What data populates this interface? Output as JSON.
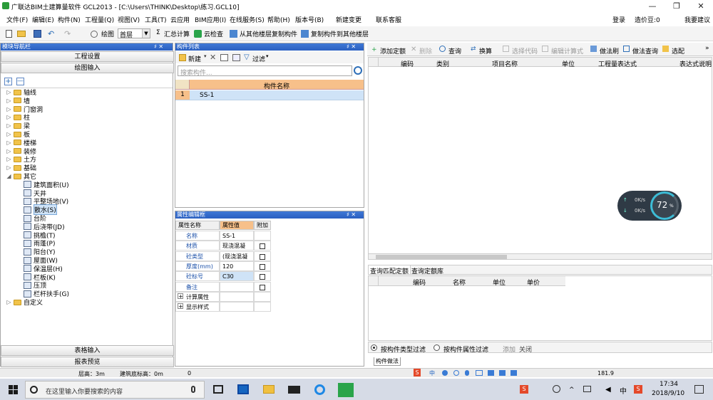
{
  "window": {
    "title": "广联达BIM土建算量软件 GCL2013 - [C:\\Users\\THINK\\Desktop\\练习.GCL10]",
    "minimize": "—",
    "restore": "❐",
    "close": "✕"
  },
  "menu": {
    "items": [
      "文件(F)",
      "编辑(E)",
      "构件(N)",
      "工程量(Q)",
      "视图(V)",
      "工具(T)",
      "云应用",
      "BIM应用(I)",
      "在线服务(S)",
      "帮助(H)",
      "版本号(B)",
      "新建变更",
      "联系客服"
    ],
    "right_items": [
      "登录",
      "造价豆:0",
      "我要建议"
    ]
  },
  "toolbar": {
    "draw": "绘图",
    "floor": "首层",
    "sum_calc": "汇总计算",
    "cloud_check": "云检查",
    "copy_from": "从其他楼层复制构件",
    "copy_to": "复制构件到其他楼层",
    "sigma": "Σ"
  },
  "left_nav": {
    "header": "模块导航栏",
    "pin": "♯ ✕",
    "btn_project_settings": "工程设置",
    "btn_drawing_input": "绘图输入",
    "btn_table_input": "表格输入",
    "btn_report_preview": "报表预览",
    "add": "+",
    "remove": "—",
    "tree": [
      {
        "label": "轴线",
        "type": "folder",
        "expander": "▷"
      },
      {
        "label": "墙",
        "type": "folder",
        "expander": "▷"
      },
      {
        "label": "门窗洞",
        "type": "folder",
        "expander": "▷"
      },
      {
        "label": "柱",
        "type": "folder",
        "expander": "▷"
      },
      {
        "label": "梁",
        "type": "folder",
        "expander": "▷"
      },
      {
        "label": "板",
        "type": "folder",
        "expander": "▷"
      },
      {
        "label": "楼梯",
        "type": "folder",
        "expander": "▷"
      },
      {
        "label": "装修",
        "type": "folder",
        "expander": "▷"
      },
      {
        "label": "土方",
        "type": "folder",
        "expander": "▷"
      },
      {
        "label": "基础",
        "type": "folder",
        "expander": "▷"
      },
      {
        "label": "其它",
        "type": "folder",
        "expander": "◢"
      },
      {
        "label": "建筑面积(U)",
        "type": "child"
      },
      {
        "label": "天井",
        "type": "child"
      },
      {
        "label": "平整场地(V)",
        "type": "child"
      },
      {
        "label": "散水(S)",
        "type": "child",
        "selected": true
      },
      {
        "label": "台阶",
        "type": "child"
      },
      {
        "label": "后浇带(JD)",
        "type": "child"
      },
      {
        "label": "挑檐(T)",
        "type": "child"
      },
      {
        "label": "雨蓬(P)",
        "type": "child"
      },
      {
        "label": "阳台(Y)",
        "type": "child"
      },
      {
        "label": "屋面(W)",
        "type": "child"
      },
      {
        "label": "保温层(H)",
        "type": "child"
      },
      {
        "label": "栏板(K)",
        "type": "child"
      },
      {
        "label": "压顶",
        "type": "child"
      },
      {
        "label": "栏杆扶手(G)",
        "type": "child"
      },
      {
        "label": "自定义",
        "type": "folder",
        "expander": "▷"
      }
    ]
  },
  "component_list": {
    "header": "构件列表",
    "pin": "♯ ✕",
    "new": "新建",
    "filter": "过滤",
    "search_placeholder": "搜索构件...",
    "column": "构件名称",
    "rows": [
      {
        "index": "1",
        "name": "SS-1"
      }
    ]
  },
  "property_editor": {
    "header": "属性编辑框",
    "pin": "♯ ✕",
    "columns": [
      "属性名称",
      "属性值",
      "附加"
    ],
    "rows": [
      {
        "name": "名称",
        "value": "SS-1",
        "has_check": false
      },
      {
        "name": "材质",
        "value": "现浇混凝",
        "has_check": true
      },
      {
        "name": "砼类型",
        "value": "(现浇混凝",
        "has_check": true
      },
      {
        "name": "厚度(mm)",
        "value": "120",
        "has_check": true
      },
      {
        "name": "砼标号",
        "value": "C30",
        "has_check": true
      },
      {
        "name": "备注",
        "value": "",
        "has_check": true
      }
    ],
    "groups": [
      "计算属性",
      "显示样式"
    ],
    "plus": "+"
  },
  "right": {
    "toolbar": [
      "添加定额",
      "删除",
      "查询",
      "换算",
      "选择代码",
      "编辑计算式",
      "做法刷",
      "做法查询",
      "选配"
    ],
    "columns": [
      "编码",
      "类别",
      "项目名称",
      "单位",
      "工程量表达式",
      "表达式说明"
    ],
    "tabs": [
      "查询匹配定额",
      "查询定额库"
    ],
    "lower_columns": [
      "编码",
      "名称",
      "单位",
      "单价"
    ],
    "radio1": "按构件类型过滤",
    "radio2": "按构件属性过滤",
    "add": "添加",
    "close": "关闭",
    "bottom_tab": "构件做法",
    "speed_up": "0K/s",
    "speed_down": "0K/s",
    "percent": "72",
    "percent_unit": "%"
  },
  "status": {
    "floor_height": "层高：3m",
    "base_elev": "建筑底标高：0m",
    "zero": "0",
    "coord": "181.9"
  },
  "taskbar": {
    "search": "在这里输入你要搜索的内容",
    "time": "17:34",
    "date": "2018/9/10",
    "ime": "中",
    "sogou": "S"
  },
  "colors": {
    "panel_header": "#2a5fc0",
    "selected_row": "#cfe3f7",
    "header_orange": "#f7c08a",
    "ring": "#3dbcd6"
  }
}
